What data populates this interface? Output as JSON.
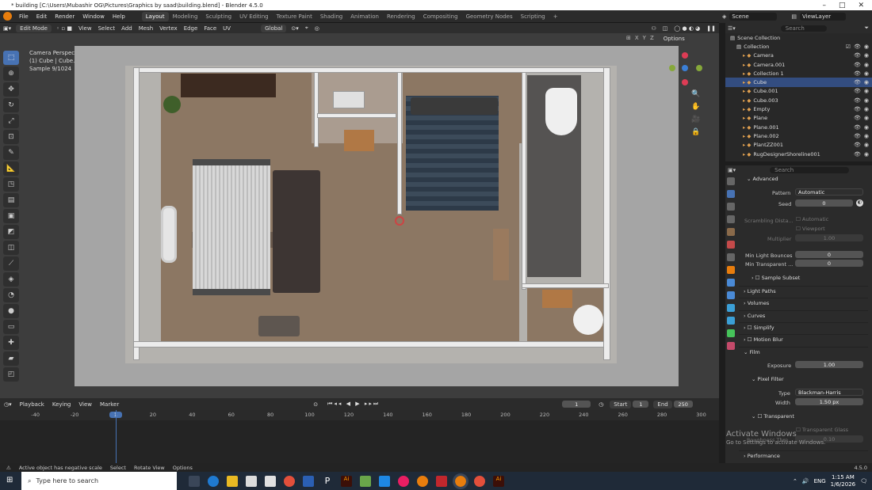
{
  "window": {
    "title": "* building [C:\\Users\\Mubashir OG\\Pictures\\Graphics by saad\\building.blend] - Blender 4.5.0",
    "min": "–",
    "max": "□",
    "close": "✕"
  },
  "menu": [
    "File",
    "Edit",
    "Render",
    "Window",
    "Help"
  ],
  "workspaces": [
    "Layout",
    "Modeling",
    "Sculpting",
    "UV Editing",
    "Texture Paint",
    "Shading",
    "Animation",
    "Rendering",
    "Compositing",
    "Geometry Nodes",
    "Scripting"
  ],
  "active_workspace": "Layout",
  "scene": {
    "label": "Scene",
    "view_layer": "ViewLayer"
  },
  "viewport": {
    "mode": "Edit Mode",
    "menus": [
      "View",
      "Select",
      "Add",
      "Mesh",
      "Vertex",
      "Edge",
      "Face",
      "UV"
    ],
    "transform": "Global",
    "options": "Options",
    "info": {
      "line1": "Camera Perspective",
      "line2": "(1) Cube | Cube.002",
      "line3": "Sample 9/1024"
    },
    "axes": [
      "X",
      "Y",
      "Z"
    ]
  },
  "outliner": {
    "search_placeholder": "Search",
    "root": "Scene Collection",
    "collection": "Collection",
    "items": [
      "Camera",
      "Camera.001",
      "Collection 1",
      "Cube",
      "Cube.001",
      "Cube.003",
      "Empty",
      "Plane",
      "Plane.001",
      "Plane.002",
      "PlantZZ001",
      "RugDesignerShoreline001"
    ],
    "selected": "Cube"
  },
  "properties": {
    "search_placeholder": "Search",
    "advanced": "Advanced",
    "pattern_label": "Pattern",
    "pattern_value": "Automatic",
    "seed_label": "Seed",
    "seed_value": "0",
    "scrambling_label": "Scrambling Dista...",
    "scrambling_auto": "Automatic",
    "scrambling_viewport": "Viewport",
    "multiplier_label": "Multiplier",
    "multiplier_value": "1.00",
    "min_bounces_label": "Min Light Bounces",
    "min_bounces_value": "0",
    "min_transparent_label": "Min Transparent ...",
    "min_transparent_value": "0",
    "sample_subset": "Sample Subset",
    "light_paths": "Light Paths",
    "volumes": "Volumes",
    "curves": "Curves",
    "simplify": "Simplify",
    "motion_blur": "Motion Blur",
    "film": "Film",
    "exposure_label": "Exposure",
    "exposure_value": "1.00",
    "pixel_filter": "Pixel Filter",
    "type_label": "Type",
    "type_value": "Blackman-Harris",
    "width_label": "Width",
    "width_value": "1.50 px",
    "transparent": "Transparent",
    "transparent_glass": "Transparent Glass",
    "roughness_label": "Roughness Thre...",
    "roughness_value": "0.10",
    "performance": "Performance"
  },
  "timeline": {
    "menus": [
      "Playback",
      "Keying",
      "View",
      "Marker"
    ],
    "current_frame": "1",
    "start_label": "Start",
    "start": "1",
    "end_label": "End",
    "end": "250",
    "ticks": [
      "-40",
      "-20",
      "1",
      "20",
      "40",
      "60",
      "80",
      "100",
      "120",
      "140",
      "160",
      "180",
      "200",
      "220",
      "240",
      "260",
      "280",
      "300"
    ],
    "current_tick": "1"
  },
  "status": {
    "msg": "Active object has negative scale",
    "select": "Select",
    "rotate": "Rotate View",
    "options": "Options",
    "version": "4.5.0"
  },
  "activate": {
    "line1": "Activate Windows",
    "line2": "Go to Settings to activate Windows."
  },
  "taskbar": {
    "search_placeholder": "Type here to search",
    "time": "1:15 AM",
    "date": "1/6/2026",
    "lang": "ENG"
  }
}
